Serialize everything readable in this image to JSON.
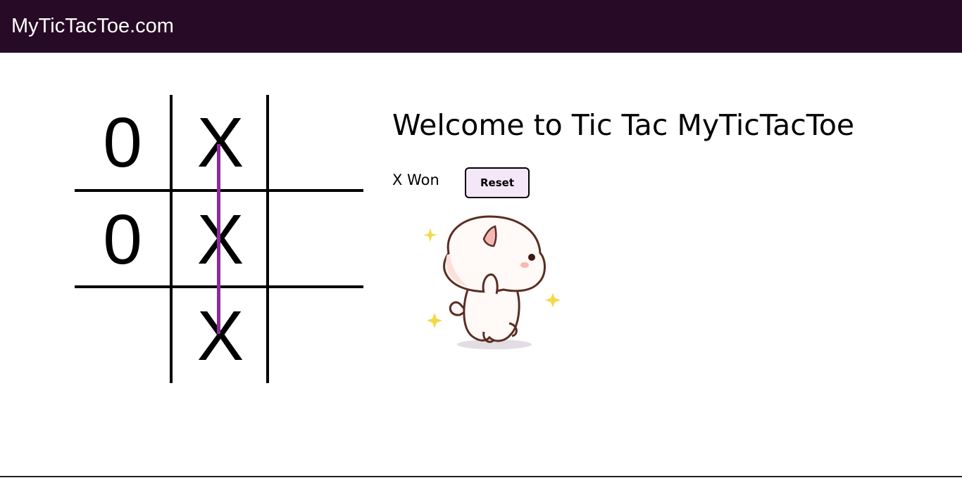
{
  "navbar": {
    "brand": "MyTicTacToe.com"
  },
  "board": {
    "cells": [
      "0",
      "X",
      "",
      "0",
      "X",
      "",
      "",
      "X",
      ""
    ],
    "winning_line": "middle-column",
    "colors": {
      "grid": "#000000",
      "win_line": "#8e2a9e"
    }
  },
  "main": {
    "title": "Welcome to Tic Tac MyTicTacToe",
    "status": "X Won",
    "reset_label": "Reset"
  },
  "sticker": {
    "icon": "cat-celebration-sticker"
  },
  "colors": {
    "navbar_bg": "#270a25",
    "reset_bg": "#f3e7f8"
  }
}
